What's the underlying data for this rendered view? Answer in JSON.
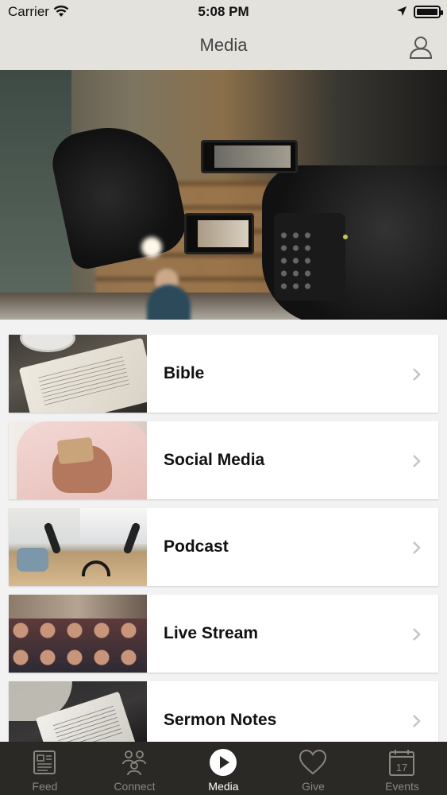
{
  "status_bar": {
    "carrier": "Carrier",
    "time": "5:08 PM"
  },
  "nav": {
    "title": "Media",
    "profile_icon": "person-icon"
  },
  "hero": {
    "image": "video-camera-studio"
  },
  "media_items": [
    {
      "label": "Bible",
      "thumb": "open-bible"
    },
    {
      "label": "Social Media",
      "thumb": "phone-in-hands"
    },
    {
      "label": "Podcast",
      "thumb": "podcast-studio"
    },
    {
      "label": "Live Stream",
      "thumb": "worship-crowd"
    },
    {
      "label": "Sermon Notes",
      "thumb": "notes-papers"
    }
  ],
  "tabs": [
    {
      "label": "Feed",
      "icon": "newspaper-icon",
      "active": false
    },
    {
      "label": "Connect",
      "icon": "people-icon",
      "active": false
    },
    {
      "label": "Media",
      "icon": "play-icon",
      "active": true
    },
    {
      "label": "Give",
      "icon": "heart-icon",
      "active": false
    },
    {
      "label": "Events",
      "icon": "calendar-icon",
      "active": false,
      "badge": "17"
    }
  ],
  "colors": {
    "nav_bg": "#e3e2dc",
    "tabbar_bg": "#2b2925",
    "tab_active": "#ffffff",
    "tab_inactive": "#8a8680"
  }
}
